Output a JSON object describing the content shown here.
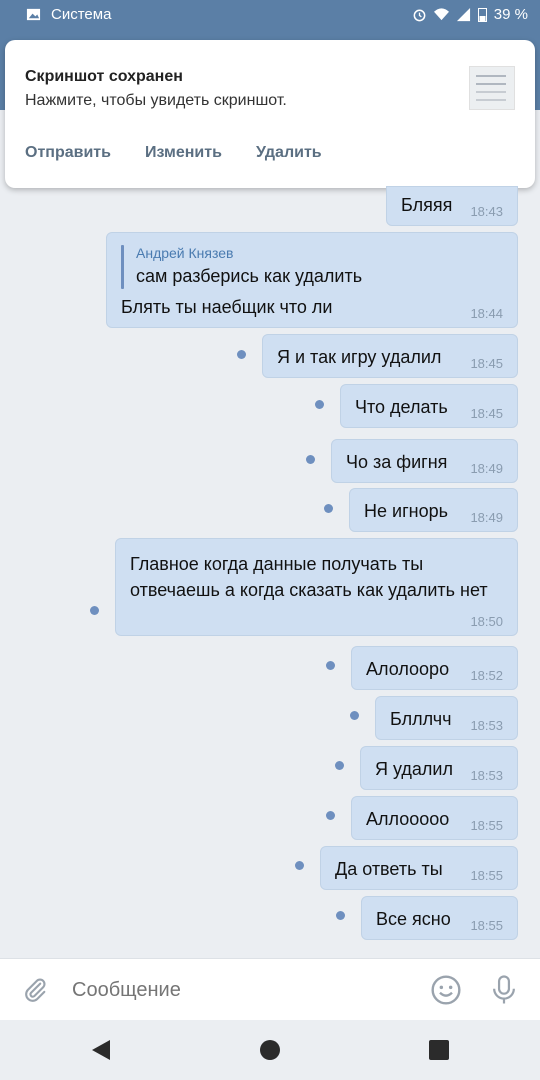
{
  "status_bar": {
    "app_label": "Система",
    "battery": "39 %"
  },
  "notification": {
    "title": "Скриншот сохранен",
    "body": "Нажмите, чтобы увидеть скриншот.",
    "actions": [
      "Отправить",
      "Изменить",
      "Удалить"
    ]
  },
  "messages": [
    {
      "text": "Бляяя",
      "time": "18:43"
    },
    {
      "reply_author": "Андрей Князев",
      "reply_text": "сам разберись как удалить",
      "text": "Блять ты наебщик что ли",
      "time": "18:44"
    },
    {
      "text": "Я и так игру удалил",
      "time": "18:45"
    },
    {
      "text": "Что делать",
      "time": "18:45"
    },
    {
      "text": "Чо за фигня",
      "time": "18:49"
    },
    {
      "text": "Не игнорь",
      "time": "18:49"
    },
    {
      "text": "Главное когда данные получать ты отвечаешь а когда сказать как удалить нет",
      "time": "18:50"
    },
    {
      "text": "Алолооро",
      "time": "18:52"
    },
    {
      "text": "Блллчч",
      "time": "18:53"
    },
    {
      "text": "Я удалил",
      "time": "18:53"
    },
    {
      "text": "Аллооооо",
      "time": "18:55"
    },
    {
      "text": "Да ответь ты",
      "time": "18:55"
    },
    {
      "text": "Все ясно",
      "time": "18:55"
    }
  ],
  "composer": {
    "placeholder": "Сообщение",
    "icons": [
      "attach-icon",
      "emoji-icon",
      "microphone-icon"
    ]
  },
  "navigation": {
    "icons": [
      "back-icon",
      "home-icon",
      "recents-icon"
    ]
  },
  "colors": {
    "accent": "#5b7fa6",
    "bubble": "#cfdff2",
    "unread_dot": "#6e8fbf",
    "background": "#ebeef2"
  }
}
